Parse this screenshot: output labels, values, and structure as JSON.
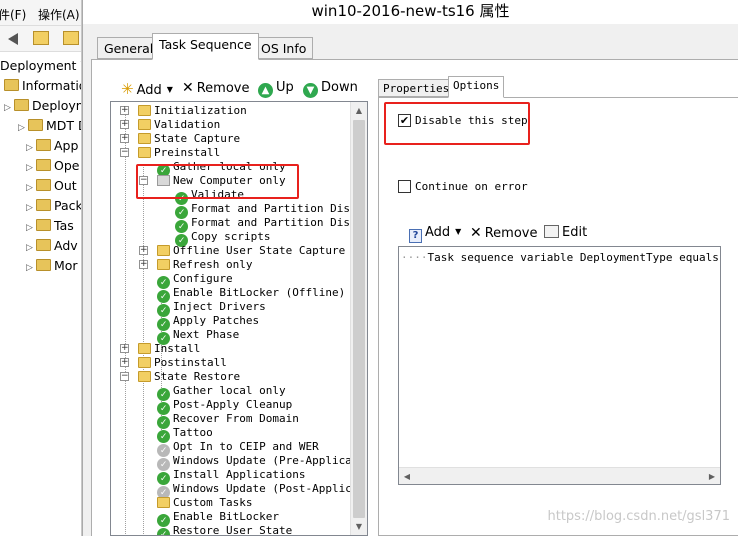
{
  "background_window": {
    "menu": [
      "件(F)",
      "操作(A)"
    ],
    "tree": [
      {
        "label": "Deployment W",
        "has_arrow": false
      },
      {
        "label": "Informatio",
        "has_arrow": false
      },
      {
        "label": "Deployme",
        "has_arrow": true
      },
      {
        "label": "MDT D",
        "has_arrow": true
      },
      {
        "label": "App",
        "has_arrow": true
      },
      {
        "label": "Ope",
        "has_arrow": true
      },
      {
        "label": "Out",
        "has_arrow": true
      },
      {
        "label": "Pack",
        "has_arrow": true
      },
      {
        "label": "Tas",
        "has_arrow": true
      },
      {
        "label": "Adv",
        "has_arrow": true
      },
      {
        "label": "Mor",
        "has_arrow": true
      }
    ]
  },
  "dialog": {
    "title": "win10-2016-new-ts16 属性",
    "tabs": [
      "General",
      "Task Sequence",
      "OS Info"
    ],
    "active_tab": "Task Sequence"
  },
  "toolbar": {
    "add": "Add",
    "remove": "Remove",
    "up": "Up",
    "down": "Down"
  },
  "tree": [
    {
      "label": "Initialization",
      "icon": "folder",
      "level": 0,
      "expander": "+"
    },
    {
      "label": "Validation",
      "icon": "folder",
      "level": 0,
      "expander": "+"
    },
    {
      "label": "State Capture",
      "icon": "folder",
      "level": 0,
      "expander": "+"
    },
    {
      "label": "Preinstall",
      "icon": "folder",
      "level": 0,
      "expander": "-"
    },
    {
      "label": "Gather local only",
      "icon": "ok",
      "level": 1,
      "expander": ""
    },
    {
      "label": "New Computer only",
      "icon": "group",
      "level": 1,
      "expander": "-"
    },
    {
      "label": "Validate",
      "icon": "ok",
      "level": 2,
      "expander": ""
    },
    {
      "label": "Format and Partition Disk (UEFI)",
      "icon": "ok",
      "level": 2,
      "expander": ""
    },
    {
      "label": "Format and Partition Disk (BIOS)",
      "icon": "ok",
      "level": 2,
      "expander": ""
    },
    {
      "label": "Copy scripts",
      "icon": "ok",
      "level": 2,
      "expander": ""
    },
    {
      "label": "Offline User State Capture",
      "icon": "folder",
      "level": 1,
      "expander": "+"
    },
    {
      "label": "Refresh only",
      "icon": "folder",
      "level": 1,
      "expander": "+"
    },
    {
      "label": "Configure",
      "icon": "ok",
      "level": 1,
      "expander": ""
    },
    {
      "label": "Enable BitLocker (Offline)",
      "icon": "ok",
      "level": 1,
      "expander": ""
    },
    {
      "label": "Inject Drivers",
      "icon": "ok",
      "level": 1,
      "expander": ""
    },
    {
      "label": "Apply Patches",
      "icon": "ok",
      "level": 1,
      "expander": ""
    },
    {
      "label": "Next Phase",
      "icon": "ok",
      "level": 1,
      "expander": ""
    },
    {
      "label": "Install",
      "icon": "folder",
      "level": 0,
      "expander": "+"
    },
    {
      "label": "Postinstall",
      "icon": "folder",
      "level": 0,
      "expander": "+"
    },
    {
      "label": "State Restore",
      "icon": "folder",
      "level": 0,
      "expander": "-"
    },
    {
      "label": "Gather local only",
      "icon": "ok",
      "level": 1,
      "expander": ""
    },
    {
      "label": "Post-Apply Cleanup",
      "icon": "ok",
      "level": 1,
      "expander": ""
    },
    {
      "label": "Recover From Domain",
      "icon": "ok",
      "level": 1,
      "expander": ""
    },
    {
      "label": "Tattoo",
      "icon": "ok",
      "level": 1,
      "expander": ""
    },
    {
      "label": "Opt In to CEIP and WER",
      "icon": "disabled",
      "level": 1,
      "expander": ""
    },
    {
      "label": "Windows Update (Pre-Application Installation)",
      "icon": "disabled",
      "level": 1,
      "expander": ""
    },
    {
      "label": "Install Applications",
      "icon": "ok",
      "level": 1,
      "expander": ""
    },
    {
      "label": "Windows Update (Post-Application Installation)",
      "icon": "disabled",
      "level": 1,
      "expander": ""
    },
    {
      "label": "Custom Tasks",
      "icon": "folder",
      "level": 1,
      "expander": ""
    },
    {
      "label": "Enable BitLocker",
      "icon": "ok",
      "level": 1,
      "expander": ""
    },
    {
      "label": "Restore User State",
      "icon": "ok",
      "level": 1,
      "expander": ""
    }
  ],
  "right": {
    "tabs": [
      "Properties",
      "Options"
    ],
    "active_tab": "Options",
    "disable_step_label": "Disable this step",
    "disable_step_checked": true,
    "continue_on_error_label": "Continue on error",
    "continue_on_error_checked": false,
    "cond_toolbar": {
      "add": "Add",
      "remove": "Remove",
      "edit": "Edit"
    },
    "condition": "Task sequence variable DeploymentType equals NEWCOMPUTER"
  },
  "watermark": "https://blog.csdn.net/gsl371",
  "colors": {
    "highlight_box": "#e8211d",
    "ok_icon": "#3aa63a",
    "folder": "#f2cf63"
  }
}
